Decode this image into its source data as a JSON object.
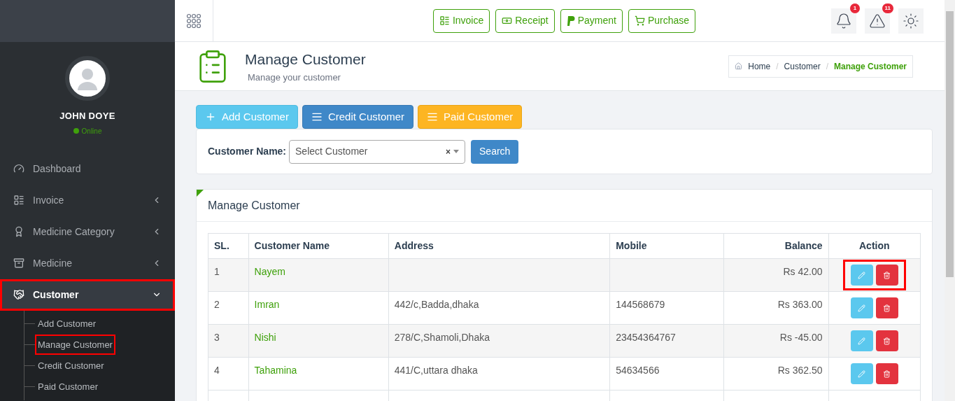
{
  "user": {
    "name": "JOHN DOYE",
    "status": "Online"
  },
  "sidebar": {
    "items": [
      {
        "kind": "dashboard",
        "label": "Dashboard",
        "expandable": false,
        "expanded": false,
        "highlighted": false
      },
      {
        "kind": "invoice",
        "label": "Invoice",
        "expandable": true,
        "expanded": false,
        "highlighted": false
      },
      {
        "kind": "category",
        "label": "Medicine Category",
        "expandable": true,
        "expanded": false,
        "highlighted": false
      },
      {
        "kind": "medicine",
        "label": "Medicine",
        "expandable": true,
        "expanded": false,
        "highlighted": false
      },
      {
        "kind": "customer",
        "label": "Customer",
        "expandable": true,
        "expanded": true,
        "highlighted": true,
        "children": [
          {
            "label": "Add Customer",
            "highlighted": false
          },
          {
            "label": "Manage Customer",
            "highlighted": true
          },
          {
            "label": "Credit Customer",
            "highlighted": false
          },
          {
            "label": "Paid Customer",
            "highlighted": false
          }
        ]
      }
    ]
  },
  "topbar": {
    "buttons": [
      {
        "kind": "invoice",
        "label": "Invoice"
      },
      {
        "kind": "receipt",
        "label": "Receipt"
      },
      {
        "kind": "payment",
        "label": "Payment"
      },
      {
        "kind": "purchase",
        "label": "Purchase"
      }
    ],
    "notifications": [
      {
        "kind": "bell",
        "badge": "1"
      },
      {
        "kind": "warning",
        "badge": "11"
      },
      {
        "kind": "settings"
      }
    ]
  },
  "page_header": {
    "title": "Manage Customer",
    "subtitle": "Manage your customer",
    "separator": "/",
    "breadcrumb": [
      {
        "label": "Home",
        "selected": false
      },
      {
        "label": "Customer",
        "selected": false
      },
      {
        "label": "Manage Customer",
        "selected": true
      }
    ]
  },
  "actions": [
    {
      "kind": "add",
      "label": "Add Customer"
    },
    {
      "kind": "credit",
      "label": "Credit Customer"
    },
    {
      "kind": "paid",
      "label": "Paid Customer"
    }
  ],
  "filter": {
    "label": "Customer Name:",
    "placeholder": "Select Customer",
    "clear": "×",
    "button": "Search"
  },
  "table": {
    "title": "Manage Customer",
    "columns": [
      "SL.",
      "Customer Name",
      "Address",
      "Mobile",
      "Balance",
      "Action"
    ],
    "rows": [
      {
        "sl": "1",
        "name": "Nayem",
        "address": "",
        "mobile": "",
        "balance": "Rs 42.00",
        "highlighted": true
      },
      {
        "sl": "2",
        "name": "Imran",
        "address": "442/c,Badda,dhaka",
        "mobile": "144568679",
        "balance": "Rs 363.00",
        "highlighted": false
      },
      {
        "sl": "3",
        "name": "Nishi",
        "address": "278/C,Shamoli,Dhaka",
        "mobile": "23454364767",
        "balance": "Rs -45.00",
        "highlighted": false
      },
      {
        "sl": "4",
        "name": "Tahamina",
        "address": "441/C,uttara dhaka",
        "mobile": "54634566",
        "balance": "Rs 362.50",
        "highlighted": false
      }
    ]
  }
}
